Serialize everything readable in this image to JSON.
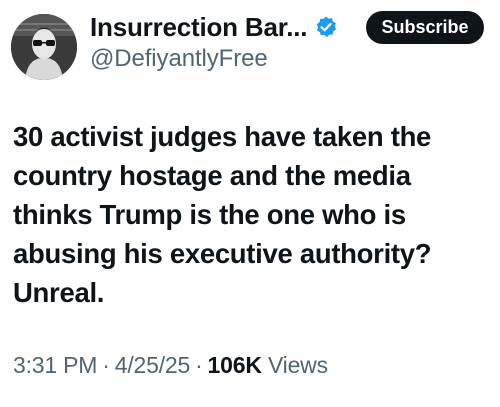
{
  "author": {
    "display_name": "Insurrection Bar...",
    "handle": "@DefiyantlyFree",
    "verified": true,
    "verified_color": "#1d9bf0",
    "avatar_icon": "profile-photo"
  },
  "actions": {
    "subscribe_label": "Subscribe"
  },
  "post": {
    "lines": [
      "30 activist judges have taken the",
      "country hostage and the media",
      "thinks Trump is the one who is",
      "abusing his executive authority?",
      "Unreal."
    ]
  },
  "meta": {
    "time": "3:31 PM",
    "separator": "·",
    "date": "4/25/25",
    "views_count": "106K",
    "views_label": "Views"
  },
  "colors": {
    "text": "#0f1419",
    "secondary": "#536471",
    "button_bg": "#0f1419",
    "button_text": "#ffffff"
  }
}
